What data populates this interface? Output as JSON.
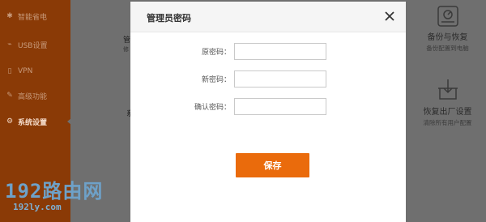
{
  "sidebar": {
    "items": [
      {
        "icon": "lightbulb-icon",
        "glyph": "✱",
        "label": "智能省电"
      },
      {
        "icon": "usb-icon",
        "glyph": "⌁",
        "label": "USB设置"
      },
      {
        "icon": "vpn-icon",
        "glyph": "▯",
        "label": "VPN"
      },
      {
        "icon": "wrench-icon",
        "glyph": "✎",
        "label": "高级功能"
      },
      {
        "icon": "gear-icon",
        "glyph": "⚙",
        "label": "系统设置"
      }
    ]
  },
  "cards": [
    {
      "icon": "backup-drive-icon",
      "title": "备份与恢复",
      "subtitle": "备份配置到电脑"
    },
    {
      "icon": "factory-reset-icon",
      "title": "恢复出厂设置",
      "subtitle": "清除所有用户配置"
    }
  ],
  "partial": {
    "left_top": "管",
    "left_top_sub": "修",
    "left_mid": "系"
  },
  "watermark": {
    "main": "192路由网",
    "sub": "192ly.com"
  },
  "modal": {
    "title": "管理员密码",
    "fields": [
      {
        "label": "原密码：",
        "value": "",
        "placeholder": ""
      },
      {
        "label": "新密码：",
        "value": "",
        "placeholder": ""
      },
      {
        "label": "确认密码：",
        "value": "",
        "placeholder": ""
      }
    ],
    "save_label": "保存"
  },
  "colors": {
    "accent": "#ea6b0c",
    "sidebar": "#8a3a06",
    "overlay": "#6f6f6f"
  }
}
